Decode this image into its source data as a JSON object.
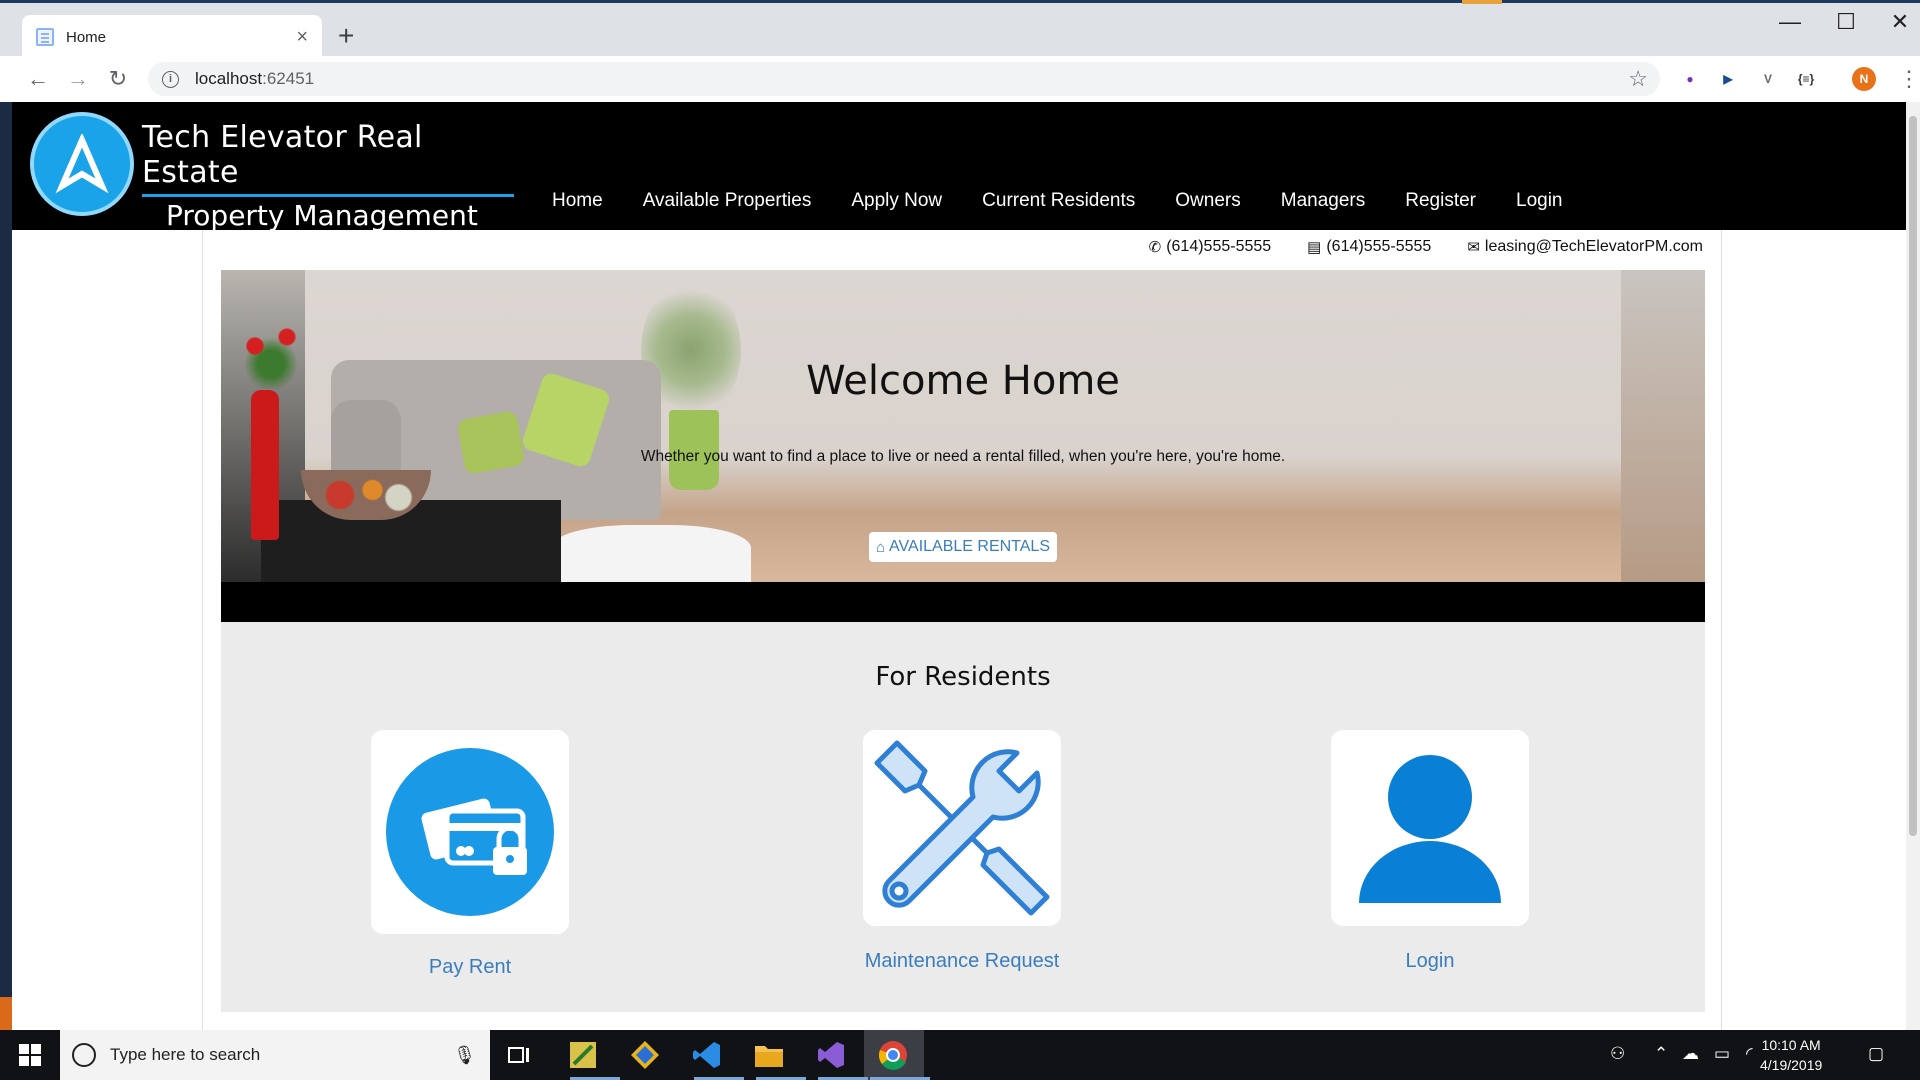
{
  "browser": {
    "tab_title": "Home",
    "tab_close": "×",
    "new_tab": "+",
    "url_host": "localhost",
    "url_port": ":62451",
    "window_controls": [
      "—",
      "☐",
      "✕"
    ],
    "extensions": [
      {
        "name": "extension-icon",
        "glyph": "●",
        "color": "#7b2fb5"
      },
      {
        "name": "play-circle-icon",
        "glyph": "▶",
        "color": "#1a4d8f"
      },
      {
        "name": "vue-devtools-icon",
        "glyph": "V",
        "color": "#666666"
      },
      {
        "name": "json-formatter-icon",
        "glyph": "{≡}",
        "color": "#333333"
      },
      {
        "name": "profile-avatar",
        "glyph": "N",
        "color": "#e8711a"
      }
    ]
  },
  "site": {
    "brand_line1": "Tech Elevator Real Estate",
    "brand_line2": "Property Management",
    "nav": [
      "Home",
      "Available Properties",
      "Apply Now",
      "Current Residents",
      "Owners",
      "Managers",
      "Register",
      "Login"
    ],
    "contact": {
      "phone": "(614)555-5555",
      "fax": "(614)555-5555",
      "email": "leasing@TechElevatorPM.com"
    },
    "hero": {
      "title": "Welcome Home",
      "subtitle": "Whether you want to find a place to live or need a rental filled, when you're here, you're home.",
      "button": "AVAILABLE RENTALS"
    },
    "residents": {
      "title": "For Residents",
      "cards": [
        "Pay Rent",
        "Maintenance Request",
        "Login"
      ]
    }
  },
  "taskbar": {
    "search_placeholder": "Type here to search",
    "time": "10:10 AM",
    "date": "4/19/2019"
  },
  "colors": {
    "brand_blue": "#1aa3e8",
    "link_blue": "#3a7dbd",
    "header_bg": "#000000",
    "residents_bg": "#ebebeb"
  }
}
